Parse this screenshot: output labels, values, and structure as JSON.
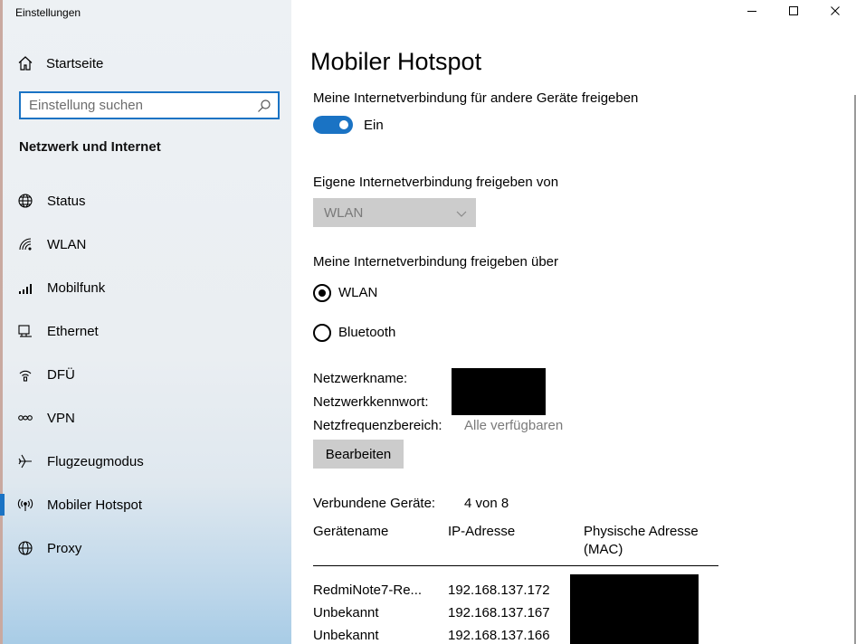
{
  "window": {
    "app_title": "Einstellungen",
    "controls": {
      "minimize": "minimize-icon",
      "maximize": "maximize-icon",
      "close": "close-icon"
    }
  },
  "sidebar": {
    "home_label": "Startseite",
    "search_placeholder": "Einstellung suchen",
    "section_title": "Netzwerk und Internet",
    "items": [
      {
        "label": "Status",
        "icon": "globe-status-icon"
      },
      {
        "label": "WLAN",
        "icon": "wifi-icon"
      },
      {
        "label": "Mobilfunk",
        "icon": "cellular-icon"
      },
      {
        "label": "Ethernet",
        "icon": "ethernet-icon"
      },
      {
        "label": "DFÜ",
        "icon": "dialup-icon"
      },
      {
        "label": "VPN",
        "icon": "vpn-icon"
      },
      {
        "label": "Flugzeugmodus",
        "icon": "airplane-icon"
      },
      {
        "label": "Mobiler Hotspot",
        "icon": "hotspot-icon",
        "active": true
      },
      {
        "label": "Proxy",
        "icon": "globe-icon"
      }
    ]
  },
  "main": {
    "title": "Mobiler Hotspot",
    "share_label": "Meine Internetverbindung für andere Geräte freigeben",
    "toggle_state": "Ein",
    "share_from_label": "Eigene Internetverbindung freigeben von",
    "share_from_value": "WLAN",
    "share_over_label": "Meine Internetverbindung freigeben über",
    "share_over_options": [
      {
        "label": "WLAN",
        "checked": true
      },
      {
        "label": "Bluetooth",
        "checked": false
      }
    ],
    "network_name_label": "Netzwerkname:",
    "network_password_label": "Netzwerkkennwort:",
    "band_label": "Netzfrequenzbereich:",
    "band_value": "Alle verfügbaren",
    "edit_button": "Bearbeiten",
    "connected_label": "Verbundene Geräte:",
    "connected_value": "4 von 8",
    "table": {
      "headers": [
        "Gerätename",
        "IP-Adresse",
        "Physische Adresse",
        "(MAC)"
      ],
      "rows": [
        {
          "name": "RedmiNote7-Re...",
          "ip": "192.168.137.172"
        },
        {
          "name": "Unbekannt",
          "ip": "192.168.137.167"
        },
        {
          "name": "Unbekannt",
          "ip": "192.168.137.166"
        }
      ]
    },
    "accent_color": "#1a73c4"
  }
}
